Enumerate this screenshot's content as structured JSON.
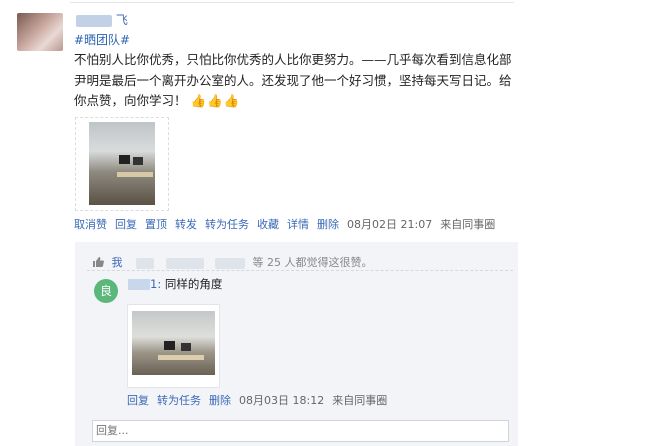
{
  "post": {
    "author_name": "飞",
    "tag": "#晒团队#",
    "body": "不怕别人比你优秀，只怕比你优秀的人比你更努力。——几乎每次看到信息化部尹明是最后一个离开办公室的人。还发现了他一个好习惯，坚持每天写日记。给你点赞，向你学习！",
    "emoji": "👍👍👍",
    "actions": [
      "取消赞",
      "回复",
      "置顶",
      "转发",
      "转为任务",
      "收藏",
      "详情",
      "删除"
    ],
    "timestamp": "08月02日 21:07",
    "source": "来自同事圈"
  },
  "likes": {
    "thumb_icon": "thumbs-up-icon",
    "me": "我",
    "suffix": "等 25 人都觉得这很赞。"
  },
  "comment": {
    "avatar_initial": "良",
    "name_tail": "1:",
    "text": "同样的角度",
    "actions": [
      "回复",
      "转为任务",
      "删除"
    ],
    "timestamp": "08月03日 18:12",
    "source": "来自同事圈"
  },
  "reply": {
    "placeholder": "回复..."
  },
  "colors": {
    "link": "#3a69b7",
    "tag": "#2d64b3",
    "comment_bg": "#f3f4f7",
    "avatar_green": "#5bb77a"
  }
}
